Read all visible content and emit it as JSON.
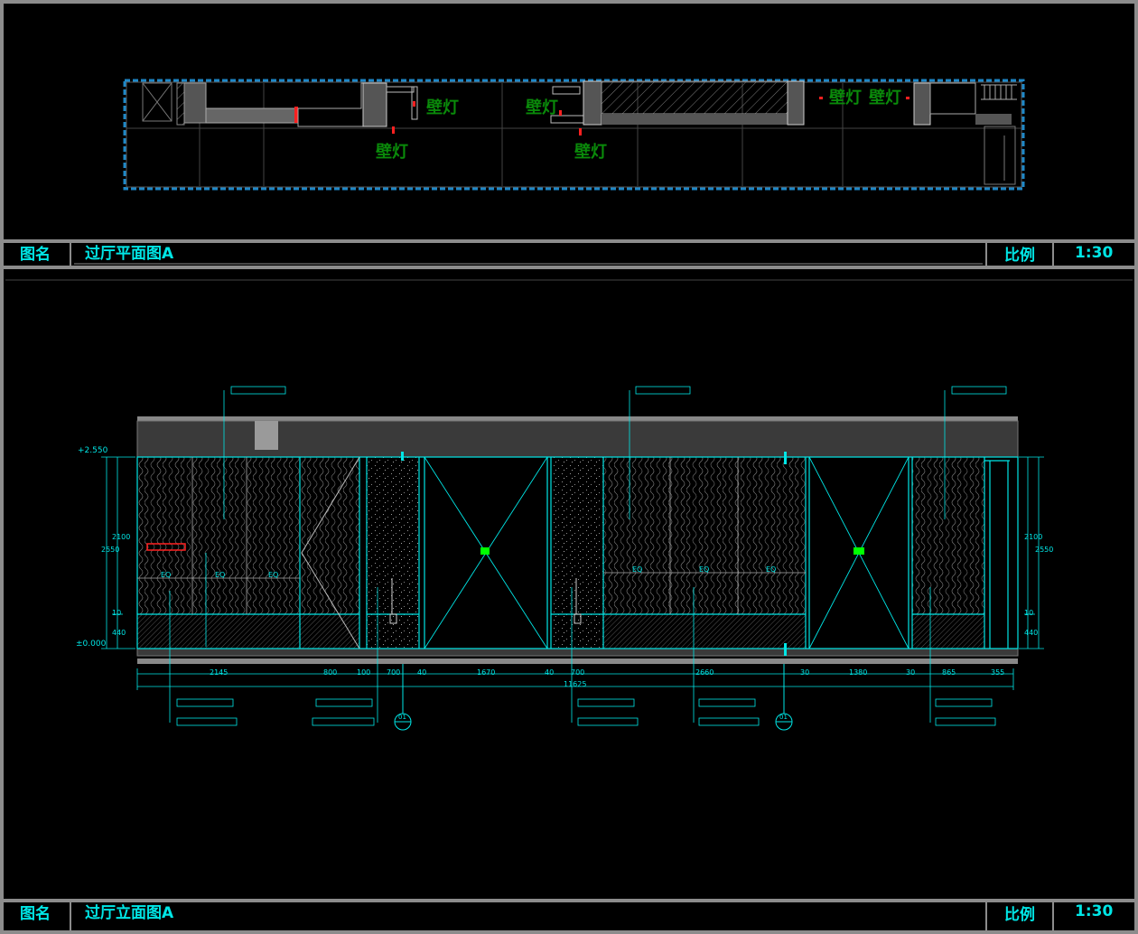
{
  "plan": {
    "title_label": "图名",
    "title": "过厅平面图A",
    "scale_label": "比例",
    "scale": "1:30",
    "fixture_labels": [
      "壁灯",
      "壁灯",
      "壁灯",
      "壁灯",
      "壁灯",
      "壁灯"
    ]
  },
  "elevation": {
    "title_label": "图名",
    "title": "过厅立面图A",
    "scale_label": "比例",
    "scale": "1:30",
    "level_top": "+2.550",
    "level_bottom": "±0.000",
    "dims_bottom": [
      "2145",
      "800",
      "100",
      "700",
      "40",
      "1670",
      "40",
      "700",
      "2660",
      "30",
      "1380",
      "30",
      "865",
      "355"
    ],
    "dim_total": "11625",
    "dims_left": [
      "2100",
      "2550",
      "440",
      "10"
    ],
    "dims_right": [
      "2100",
      "2550",
      "440",
      "10"
    ],
    "eq_labels": [
      "EQ",
      "EQ",
      "EQ",
      "EQ",
      "EQ",
      "EQ"
    ],
    "center_marks": [
      "01",
      "01"
    ],
    "colors": {
      "cyan": "#00e6e6",
      "green": "#0a8a0a",
      "bright_green": "#00ff00",
      "red": "#ff2020",
      "frame": "#8c8c8c"
    }
  }
}
